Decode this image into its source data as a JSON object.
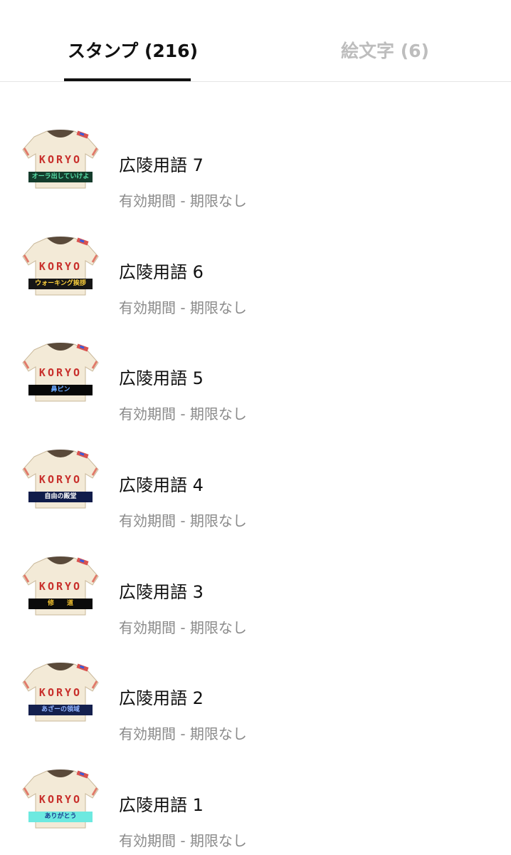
{
  "tabs": [
    {
      "label": "スタンプ (216)",
      "selected": true
    },
    {
      "label": "絵文字 (6)",
      "selected": false
    }
  ],
  "colors": {
    "accent": "#111111",
    "inactive_tab": "#bdbdbd",
    "subtitle": "#8a8a8a",
    "jersey": "#f3ead7",
    "jersey_text": "#c8302c"
  },
  "items": [
    {
      "title": "広陵用語 7",
      "subtitle": "有効期間 - 期限なし",
      "jersey_text": "KORYO",
      "caption": "オーラ出していけよ",
      "caption_bg": "#143c2c",
      "caption_color": "#59e0a8"
    },
    {
      "title": "広陵用語 6",
      "subtitle": "有効期間 - 期限なし",
      "jersey_text": "KORYO",
      "caption": "ウォーキング挨拶",
      "caption_bg": "#161616",
      "caption_color": "#ffd23c"
    },
    {
      "title": "広陵用語 5",
      "subtitle": "有効期間 - 期限なし",
      "jersey_text": "KORYO",
      "caption": "鼻ピン",
      "caption_bg": "#080808",
      "caption_color": "#69a8ff"
    },
    {
      "title": "広陵用語 4",
      "subtitle": "有効期間 - 期限なし",
      "jersey_text": "KORYO",
      "caption": "自由の殿堂",
      "caption_bg": "#101c4a",
      "caption_color": "#ffffff"
    },
    {
      "title": "広陵用語 3",
      "subtitle": "有効期間 - 期限なし",
      "jersey_text": "KORYO",
      "caption": "修　　道",
      "caption_bg": "#0b0b0b",
      "caption_color": "#f2c12e"
    },
    {
      "title": "広陵用語 2",
      "subtitle": "有効期間 - 期限なし",
      "jersey_text": "KORYO",
      "caption": "あざーの領域",
      "caption_bg": "#14204e",
      "caption_color": "#8fb2ff"
    },
    {
      "title": "広陵用語 1",
      "subtitle": "有効期間 - 期限なし",
      "jersey_text": "KORYO",
      "caption": "ありがとう",
      "caption_bg": "#6de9e0",
      "caption_color": "#1a3b8f"
    }
  ]
}
